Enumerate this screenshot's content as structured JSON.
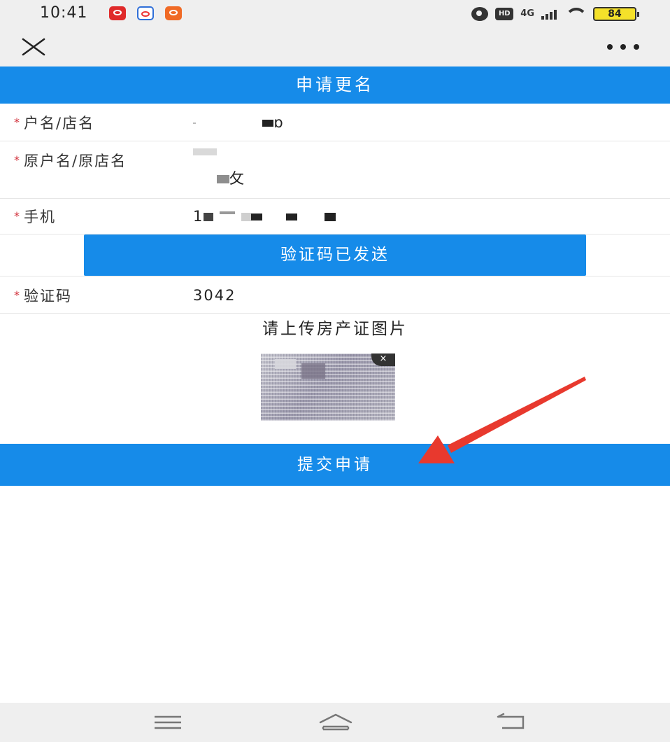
{
  "status_bar": {
    "time": "10:41",
    "network": "4G",
    "hd_badge": "HD",
    "battery": "84",
    "app_icons": [
      "netease-music-icon",
      "baidu-icon",
      "app-icon"
    ]
  },
  "title_bar": {
    "close_icon": "close-icon",
    "more_icon": "more-icon"
  },
  "header": {
    "title": "申请更名"
  },
  "form": {
    "name_label": "户名/店名",
    "name_value_tail": "ɒ",
    "orig_label": "原户名/原店名",
    "orig_value_tail": "攵",
    "phone_label": "手机",
    "phone_value_head": "1",
    "code_label": "验证码",
    "code_value": "3042",
    "required_mark": "*"
  },
  "buttons": {
    "send_code": "验证码已发送",
    "submit": "提交申请"
  },
  "upload": {
    "title": "请上传房产证图片",
    "thumb_close": "×"
  },
  "colors": {
    "primary": "#168be9",
    "required": "#d2323c",
    "annotation_arrow": "#e8392e"
  }
}
